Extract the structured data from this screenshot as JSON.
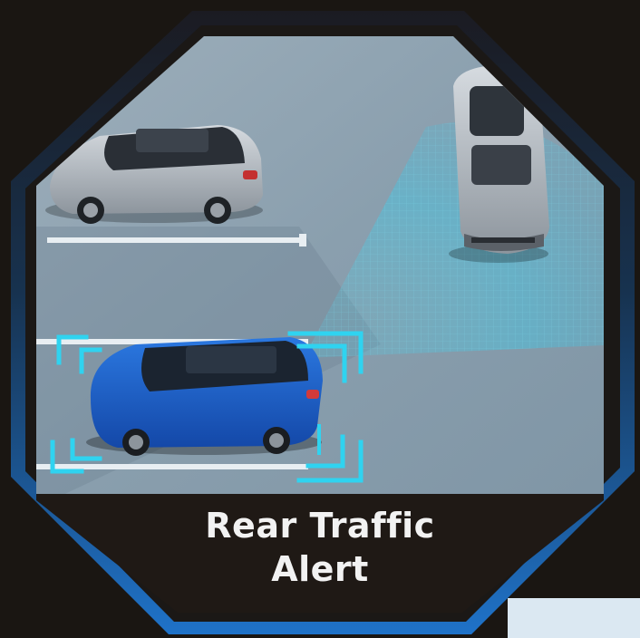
{
  "caption": {
    "line1": "Rear Traffic",
    "line2": "Alert"
  },
  "colors": {
    "background": "#1a1612",
    "frame_blue": "#1f6fc4",
    "road": "#8fa4b3",
    "sensor_cyan": "#2fd3f0",
    "ego_car_blue": "#1e5fc9",
    "parked_car_silver": "#b9bfc6",
    "caption_panel": "#1f1915",
    "caption_text": "#f2f2f2"
  },
  "scene": {
    "ego_car": "blue-suv-reversing",
    "parked_car": "silver-suv-parked",
    "crossing_car": "silver-suv-crossing",
    "detection_zone": "rear-radar-fan"
  }
}
